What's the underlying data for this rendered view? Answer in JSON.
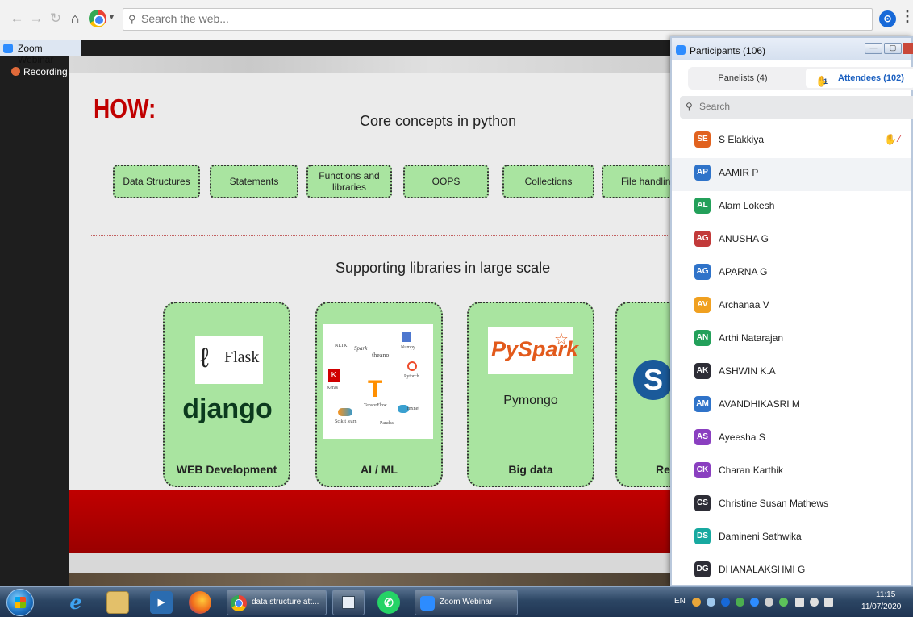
{
  "browser": {
    "search_placeholder": "Search the web...",
    "menu_glyph": "⋮"
  },
  "zoom_window": {
    "title": "Zoom Webinar",
    "recording_label": "Recording"
  },
  "slide": {
    "heading": "HOW:",
    "subtitle_1": "Core concepts in python",
    "concepts": [
      "Data Structures",
      "Statements",
      "Functions and libraries",
      "OOPS",
      "Collections",
      "File handling"
    ],
    "subtitle_2": "Supporting libraries in large scale",
    "cards": [
      {
        "caption": "WEB Development",
        "logos": [
          "Flask",
          "django"
        ]
      },
      {
        "caption": "AI / ML",
        "logos": [
          "NLTK",
          "Spark",
          "theano",
          "Numpy",
          "Keras",
          "Pytorch",
          "TensorFlow",
          "mxnet",
          "Scikit learn",
          "Pandas"
        ]
      },
      {
        "caption": "Big data",
        "logos": [
          "PySpark",
          "Pymongo"
        ]
      },
      {
        "caption": "Re",
        "logos": [
          "S"
        ]
      }
    ]
  },
  "participants": {
    "title": "Participants (106)",
    "tabs": {
      "panelists": "Panelists (4)",
      "attendees": "Attendees (102)",
      "raised_hands": "1"
    },
    "search_placeholder": "Search",
    "list": [
      {
        "initials": "SE",
        "name": "S Elakkiya",
        "color": "#e1621f",
        "hand_raised": true
      },
      {
        "initials": "AP",
        "name": "AAMIR P",
        "color": "#2f73c9"
      },
      {
        "initials": "AL",
        "name": "Alam Lokesh",
        "color": "#23a05a"
      },
      {
        "initials": "AG",
        "name": "ANUSHA G",
        "color": "#c23a3a"
      },
      {
        "initials": "AG",
        "name": "APARNA G",
        "color": "#2f73c9"
      },
      {
        "initials": "AV",
        "name": "Archanaa V",
        "color": "#f0a020"
      },
      {
        "initials": "AN",
        "name": "Arthi Natarajan",
        "color": "#23a05a"
      },
      {
        "initials": "AK",
        "name": "ASHWIN K.A",
        "color": "#2d2d36"
      },
      {
        "initials": "AM",
        "name": "AVANDHIKASRI M",
        "color": "#2f73c9"
      },
      {
        "initials": "AS",
        "name": "Ayeesha S",
        "color": "#8a3fc0"
      },
      {
        "initials": "CK",
        "name": "Charan Karthik",
        "color": "#8a3fc0"
      },
      {
        "initials": "CS",
        "name": "Christine Susan Mathews",
        "color": "#2d2d36"
      },
      {
        "initials": "DS",
        "name": "Damineni Sathwika",
        "color": "#17a9a0"
      },
      {
        "initials": "DG",
        "name": "DHANALAKSHMI G",
        "color": "#2d2d36"
      }
    ]
  },
  "taskbar": {
    "chrome_task_label": "data structure att...",
    "zoom_task_label": "Zoom Webinar",
    "language": "EN",
    "clock_time": "11:15",
    "clock_date": "11/07/2020"
  }
}
